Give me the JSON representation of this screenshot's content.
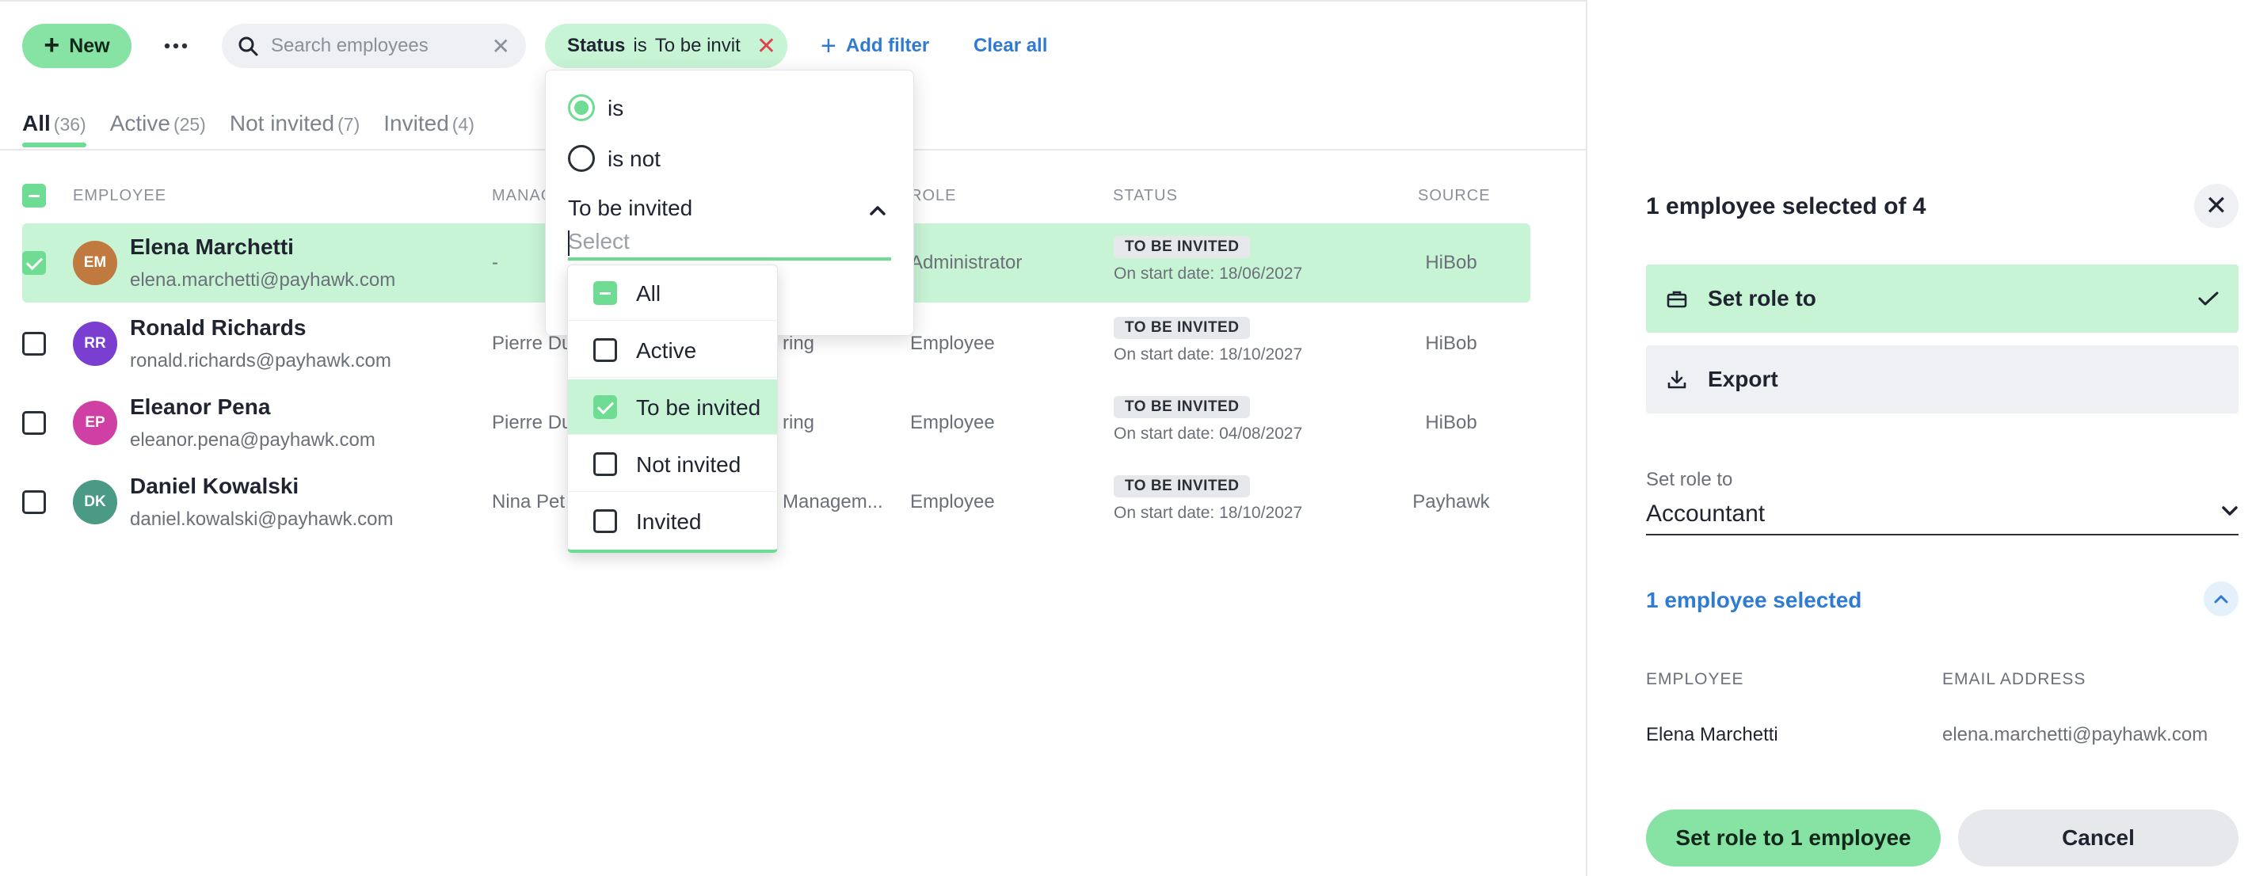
{
  "toolbar": {
    "new_label": "New",
    "more_label": "···",
    "search_placeholder": "Search employees",
    "filter_chip": {
      "key": "Status",
      "operator": "is",
      "value": "To be invit"
    },
    "add_filter_label": "Add filter",
    "clear_all_label": "Clear all"
  },
  "tabs": [
    {
      "label": "All",
      "count": "(36)"
    },
    {
      "label": "Active",
      "count": "(25)"
    },
    {
      "label": "Not invited",
      "count": "(7)"
    },
    {
      "label": "Invited",
      "count": "(4)"
    }
  ],
  "table": {
    "headers": {
      "employee": "EMPLOYEE",
      "manager": "MANAG",
      "role": "ROLE",
      "status": "STATUS",
      "source": "SOURCE"
    },
    "rows": [
      {
        "initials": "EM",
        "avatar_color": "#c07a3f",
        "name": "Elena Marchetti",
        "email": "elena.marchetti@payhawk.com",
        "manager": "-",
        "department": "",
        "role": "Administrator",
        "status": "TO BE INVITED",
        "start_date": "On start date: 18/06/2027",
        "source": "HiBob",
        "selected": true
      },
      {
        "initials": "RR",
        "avatar_color": "#7a3fd0",
        "name": "Ronald Richards",
        "email": "ronald.richards@payhawk.com",
        "manager": "Pierre Du",
        "department": "ring",
        "role": "Employee",
        "status": "TO BE INVITED",
        "start_date": "On start date: 18/10/2027",
        "source": "HiBob",
        "selected": false
      },
      {
        "initials": "EP",
        "avatar_color": "#d03fa4",
        "name": "Eleanor Pena",
        "email": "eleanor.pena@payhawk.com",
        "manager": "Pierre Du",
        "department": "ring",
        "role": "Employee",
        "status": "TO BE INVITED",
        "start_date": "On start date: 04/08/2027",
        "source": "HiBob",
        "selected": false
      },
      {
        "initials": "DK",
        "avatar_color": "#4a9a86",
        "name": "Daniel Kowalski",
        "email": "daniel.kowalski@payhawk.com",
        "manager": "Nina Pet",
        "department": "Managem...",
        "role": "Employee",
        "status": "TO BE INVITED",
        "start_date": "On start date: 18/10/2027",
        "source": "Payhawk",
        "selected": false
      }
    ]
  },
  "filter_popup": {
    "radio_is": "is",
    "radio_is_not": "is not",
    "select_label": "To be invited",
    "select_placeholder": "Select",
    "options": [
      {
        "label": "All",
        "state": "indeterminate"
      },
      {
        "label": "Active",
        "state": "unchecked"
      },
      {
        "label": "To be invited",
        "state": "checked"
      },
      {
        "label": "Not invited",
        "state": "unchecked"
      },
      {
        "label": "Invited",
        "state": "unchecked"
      }
    ]
  },
  "panel": {
    "title": "1 employee selected of 4",
    "close_icon": "close-icon",
    "actions": [
      {
        "label": "Set role to",
        "icon": "briefcase-icon"
      },
      {
        "label": "Export",
        "icon": "download-icon"
      }
    ],
    "field_label": "Set role to",
    "field_value": "Accountant",
    "selected_summary": "1 employee selected",
    "columns": {
      "employee": "EMPLOYEE",
      "email": "EMAIL ADDRESS"
    },
    "selected_rows": [
      {
        "name": "Elena Marchetti",
        "email": "elena.marchetti@payhawk.com"
      }
    ],
    "primary_button": "Set role to 1 employee",
    "secondary_button": "Cancel"
  },
  "colors": {
    "accent_green": "#6fdc93",
    "selection_bg": "#c8f4d6",
    "link_blue": "#2f7bd2",
    "danger_red": "#e1434b"
  }
}
